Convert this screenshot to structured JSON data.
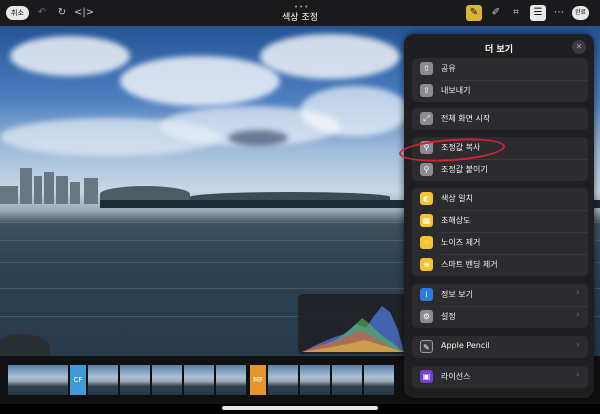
{
  "toolbar": {
    "cancel_label": "취소",
    "title": "색상 조정",
    "done_label": "완료",
    "icons": [
      "undo-icon",
      "redo-icon",
      "compare-icon",
      "auto-adjust-icon",
      "retouch-brush-icon",
      "crop-icon",
      "adjust-sliders-icon",
      "more-icon"
    ]
  },
  "menu": {
    "title": "더 보기",
    "groups": [
      {
        "items": [
          {
            "label": "공유",
            "icon": "share-icon"
          },
          {
            "label": "내보내기",
            "icon": "export-icon"
          }
        ]
      },
      {
        "items": [
          {
            "label": "전체 화면 시작",
            "icon": "fullscreen-icon"
          }
        ]
      },
      {
        "items": [
          {
            "label": "조정값 복사",
            "icon": "copy-adjustments-icon"
          },
          {
            "label": "조정값 붙이기",
            "icon": "paste-adjustments-icon"
          }
        ]
      },
      {
        "items": [
          {
            "label": "색상 일치",
            "icon": "color-match-icon"
          },
          {
            "label": "초해상도",
            "icon": "super-resolution-icon"
          },
          {
            "label": "노이즈 제거",
            "icon": "noise-reduction-icon"
          },
          {
            "label": "스마트 밴딩 제거",
            "icon": "smart-debanding-icon"
          }
        ]
      },
      {
        "items": [
          {
            "label": "정보 보기",
            "icon": "info-icon",
            "chevron": true
          },
          {
            "label": "설정",
            "icon": "settings-icon",
            "chevron": true
          }
        ]
      },
      {
        "items": [
          {
            "label": "Apple Pencil",
            "icon": "pencil-icon",
            "chevron": true
          }
        ]
      },
      {
        "items": [
          {
            "label": "라이선스",
            "icon": "license-icon",
            "chevron": true
          }
        ]
      }
    ]
  },
  "filmstrip": {
    "badges": [
      "CF",
      "MF"
    ]
  },
  "colors": {
    "annotation": "#d32230",
    "highlight": "#d7b63a",
    "menu_bg": "#1f1f22",
    "accent_yellow": "#f4c430"
  }
}
